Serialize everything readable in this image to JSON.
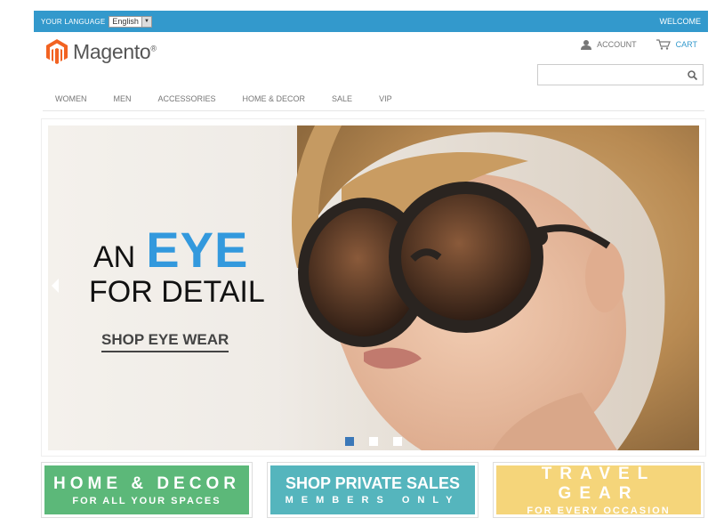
{
  "topbar": {
    "language_label": "YOUR LANGUAGE",
    "language_value": "English",
    "welcome": "WELCOME"
  },
  "header": {
    "logo_text": "Magento",
    "logo_mark": "®",
    "account_label": "ACCOUNT",
    "cart_label": "CART"
  },
  "search": {
    "placeholder": ""
  },
  "nav": {
    "items": [
      "WOMEN",
      "MEN",
      "ACCESSORIES",
      "HOME & DECOR",
      "SALE",
      "VIP"
    ]
  },
  "hero": {
    "line1_a": "AN",
    "line1_b": "EYE",
    "line2": "FOR DETAIL",
    "cta": "SHOP EYE WEAR",
    "slide_count": 3,
    "active_slide": 1
  },
  "promos": [
    {
      "title": "HOME & DECOR",
      "subtitle": "FOR ALL YOUR SPACES"
    },
    {
      "title": "SHOP PRIVATE SALES",
      "subtitle": "MEMBERS ONLY"
    },
    {
      "title": "TRAVEL GEAR",
      "subtitle": "FOR EVERY OCCASION"
    }
  ],
  "colors": {
    "topbar": "#3399cc",
    "accent_blue": "#3399dd",
    "promo_green": "#5cb879",
    "promo_teal": "#55b5bd",
    "promo_yellow": "#f5d57a",
    "logo_orange": "#f26322"
  },
  "icons": {
    "account": "user-icon",
    "cart": "cart-icon",
    "search": "search-icon",
    "slider_prev": "chevron-left-icon"
  }
}
